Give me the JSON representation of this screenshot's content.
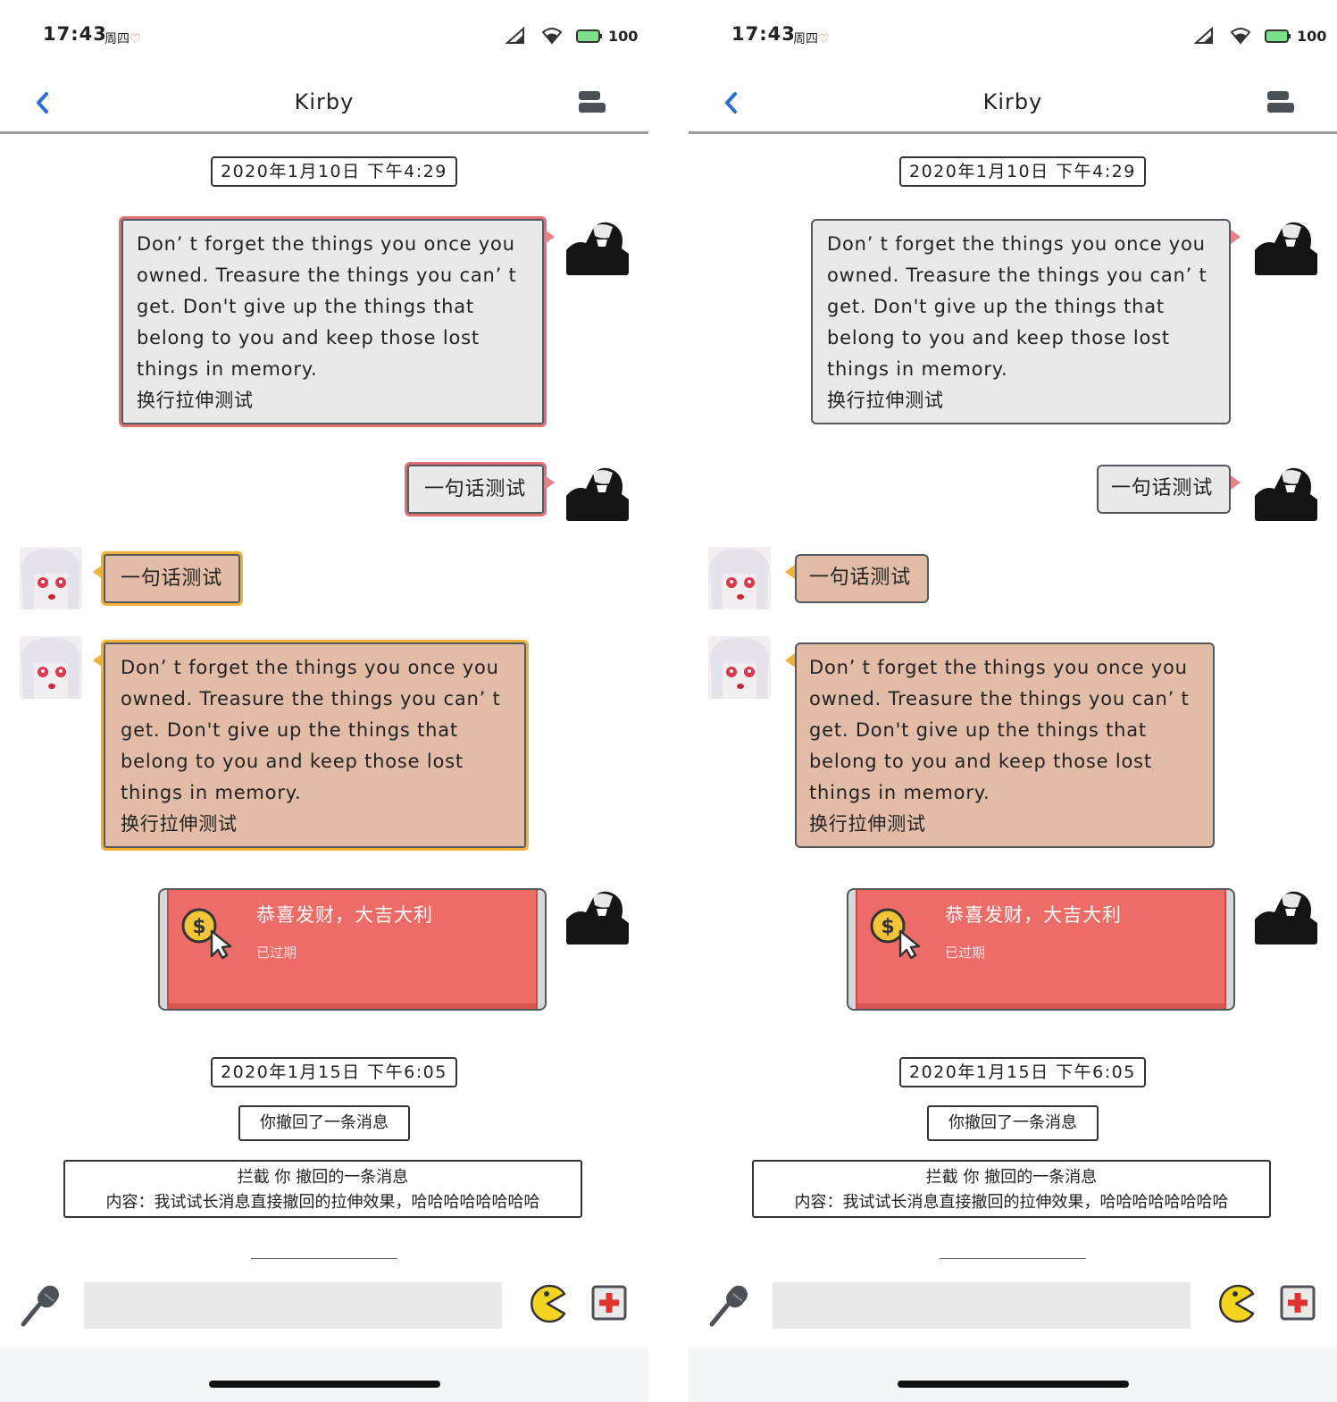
{
  "status": {
    "time": "17:43",
    "day": "周四",
    "battery": "100"
  },
  "header": {
    "title": "Kirby"
  },
  "timestamps": [
    "2020年1月10日 下午4:29",
    "2020年1月15日 下午6:05"
  ],
  "messages": {
    "long_text": "Don’ t forget the things you once you\nowned. Treasure the things you can’ t\nget. Don't give up the things that\nbelong to you and keep those lost\nthings in memory.\n换行拉伸测试",
    "short_text": "一句话测试"
  },
  "red_packet": {
    "title": "恭喜发财，大吉大利",
    "status": "已过期"
  },
  "system": {
    "recalled": "你撤回了一条消息",
    "intercept_line1": "拦截 你 撤回的一条消息",
    "intercept_line2": "内容：我试试长消息直接撤回的拉伸效果，哈哈哈哈哈哈哈哈"
  },
  "colors": {
    "accent_blue": "#2b6fd6",
    "bubble_gray": "#e9e9ea",
    "bubble_tan": "#e2bca7",
    "pink_border": "#e06f72",
    "gold_border": "#f0b136",
    "red_packet": "#ee6c68"
  }
}
